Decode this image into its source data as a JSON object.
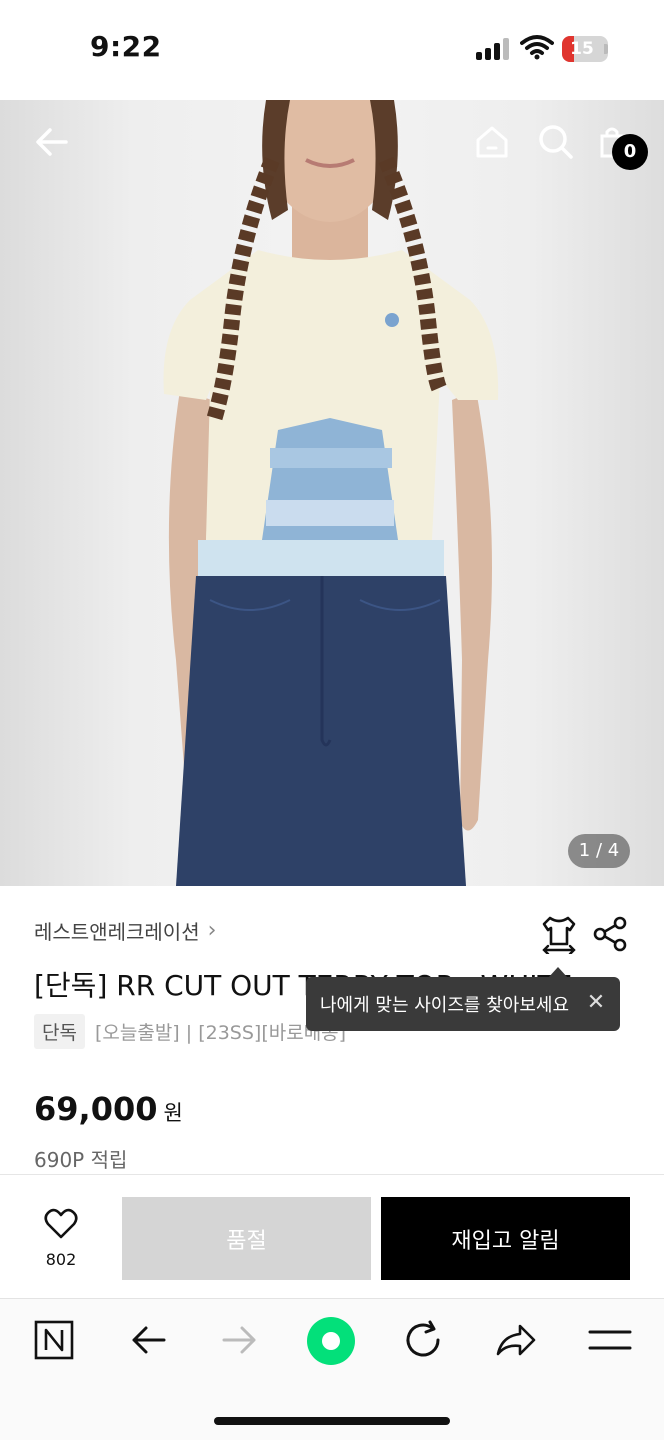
{
  "status_bar": {
    "time": "9:22",
    "battery": "15"
  },
  "hero": {
    "page_indicator": "1 / 4",
    "cart_count": "0"
  },
  "product": {
    "brand": "레스트앤레크레이션",
    "title": "[단독] RR CUT OUT TERRY TOP - WHITE",
    "tag_chip": "단독",
    "tag_text": "[오늘출발] | [23SS][바로배송]",
    "price": "69,000",
    "price_unit": "원",
    "points": "690P 적립"
  },
  "tooltip": {
    "text": "나에게 맞는 사이즈를 찾아보세요"
  },
  "actions": {
    "like_count": "802",
    "soldout_label": "품절",
    "restock_label": "재입고 알림"
  },
  "colors": {
    "accent": "#000000",
    "soldout": "#d5d5d5",
    "naver_green": "#03c75a"
  },
  "icons": [
    "back-arrow-icon",
    "home-icon",
    "search-icon",
    "cart-icon",
    "size-guide-icon",
    "share-icon",
    "heart-icon",
    "naver-icon",
    "back-icon",
    "forward-icon",
    "green-dot-icon",
    "refresh-icon",
    "share-arrow-icon",
    "menu-icon"
  ]
}
